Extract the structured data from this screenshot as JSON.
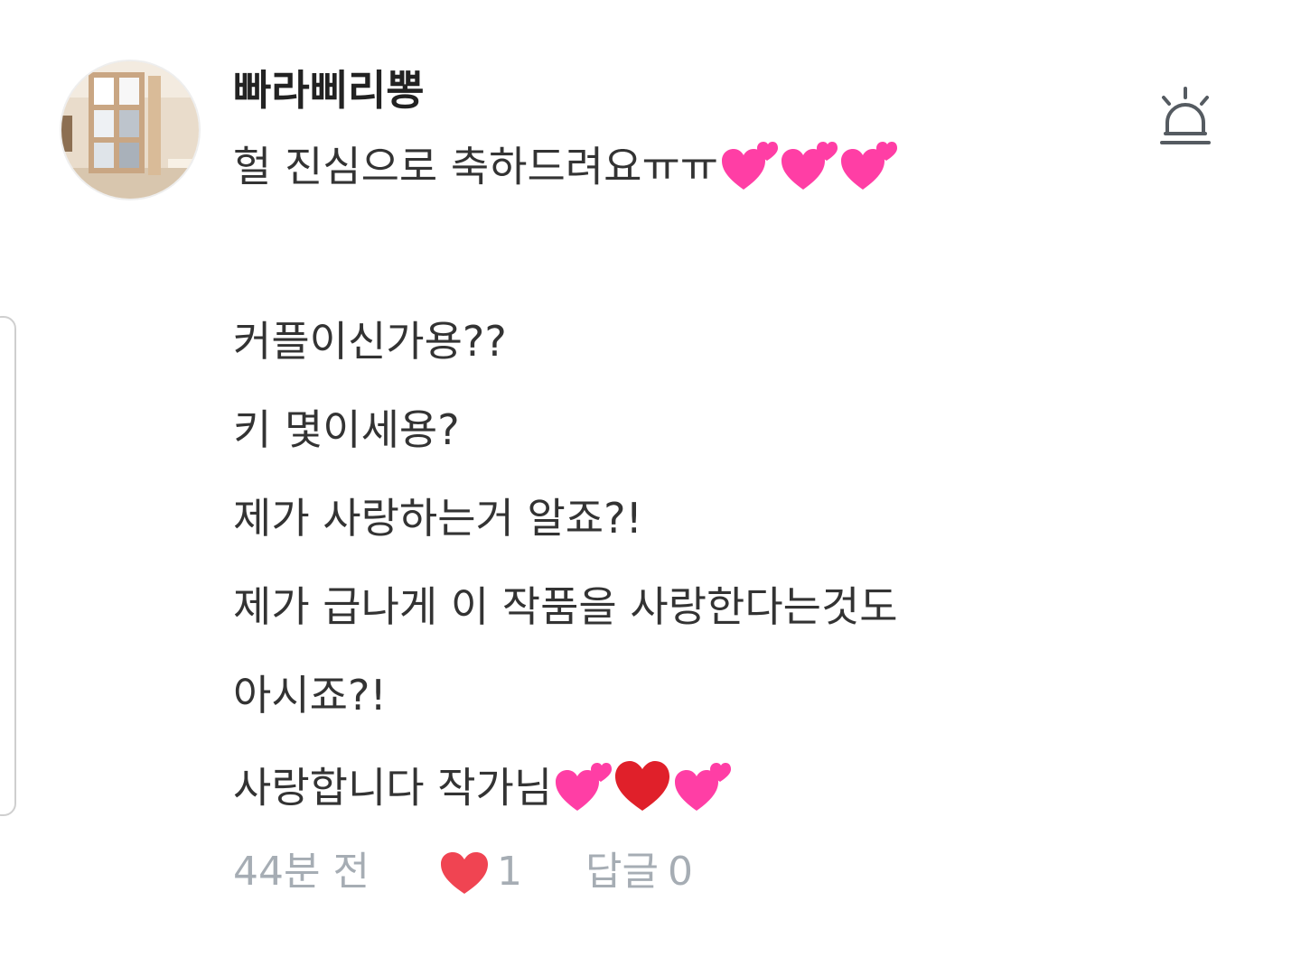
{
  "comment": {
    "username": "빠라삐리뽕",
    "lines": [
      "헐 진심으로 축하드려요ㅠㅠ",
      "커플이신가용??",
      "키 몇이세용?",
      "제가 사랑하는거 알죠?!",
      "제가 급나게 이 작품을 사랑한다는것도",
      "아시죠?!",
      "사랑합니다 작가님"
    ],
    "emoji_line1": [
      "two-hearts",
      "two-hearts",
      "two-hearts"
    ],
    "emoji_line7": [
      "two-hearts",
      "red-heart",
      "two-hearts"
    ],
    "time": "44분 전",
    "likes": "1",
    "reply_label": "답글",
    "reply_count": "0"
  },
  "icons": {
    "report": "siren-icon",
    "like": "heart-icon"
  },
  "colors": {
    "username": "#222222",
    "body_text": "#333333",
    "meta_text": "#a6adb4",
    "like_heart": "#f04452",
    "emoji_pink": "#ff3ea5",
    "emoji_red": "#e0202a"
  }
}
